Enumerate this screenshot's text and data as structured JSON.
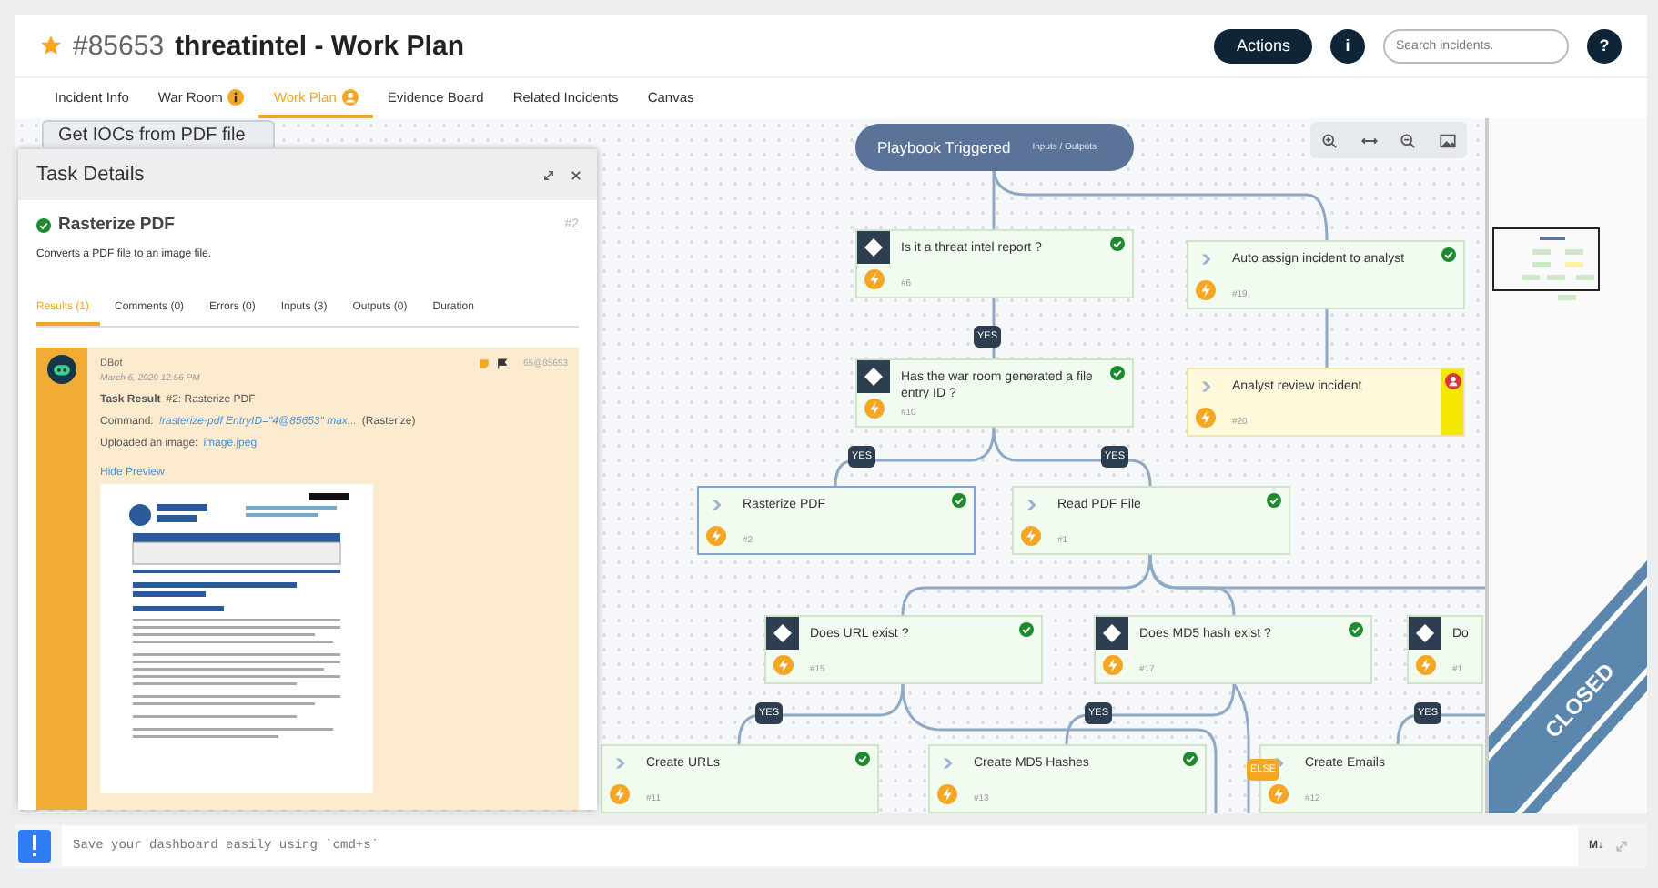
{
  "header": {
    "starred": true,
    "incident_id": "#85653",
    "title": "threatintel - Work Plan",
    "actions_label": "Actions",
    "info_label": "i",
    "search": {
      "placeholder": "Search incidents."
    },
    "help_label": "?"
  },
  "tabs": [
    {
      "kind": "plain",
      "label": "Incident Info",
      "selected": false
    },
    {
      "kind": "info",
      "label": "War Room",
      "selected": false
    },
    {
      "kind": "user",
      "label": "Work Plan",
      "selected": true
    },
    {
      "kind": "plain",
      "label": "Evidence Board",
      "selected": false
    },
    {
      "kind": "plain",
      "label": "Related Incidents",
      "selected": false
    },
    {
      "kind": "plain",
      "label": "Canvas",
      "selected": false
    }
  ],
  "canvas": {
    "nodes": [
      {
        "kind": "plain",
        "title": "Get IOCs from PDF file"
      },
      {
        "kind": "trigger",
        "title": "Playbook Triggered",
        "subtitle": "Inputs / Outputs"
      },
      {
        "kind": "decision",
        "title": "Is it a threat intel report ?",
        "id": "#6",
        "completed": true,
        "waiting": false,
        "selected": false
      },
      {
        "kind": "action",
        "title": "Auto assign incident to analyst",
        "id": "#19",
        "completed": true,
        "waiting": false,
        "selected": false
      },
      {
        "kind": "decision",
        "title": "Has the war room generated a file entry ID ?",
        "id": "#10",
        "completed": true,
        "waiting": false,
        "selected": false
      },
      {
        "kind": "action",
        "title": "Analyst review incident",
        "id": "#20",
        "completed": false,
        "waiting": true,
        "selected": false
      },
      {
        "kind": "action",
        "title": "Rasterize PDF",
        "id": "#2",
        "completed": true,
        "waiting": false,
        "selected": true
      },
      {
        "kind": "action",
        "title": "Read PDF File",
        "id": "#1",
        "completed": true,
        "waiting": false,
        "selected": false
      },
      {
        "kind": "decision",
        "title": "Does URL exist ?",
        "id": "#15",
        "completed": true,
        "waiting": false,
        "selected": false
      },
      {
        "kind": "decision",
        "title": "Does MD5 hash exist ?",
        "id": "#17",
        "completed": true,
        "waiting": false,
        "selected": false
      },
      {
        "kind": "decision",
        "title": "Do",
        "id": "#1",
        "completed": false,
        "waiting": false,
        "selected": false
      },
      {
        "kind": "action",
        "title": "Create URLs",
        "id": "#11",
        "completed": true,
        "waiting": false,
        "selected": false
      },
      {
        "kind": "action",
        "title": "Create MD5 Hashes",
        "id": "#13",
        "completed": true,
        "waiting": false,
        "selected": false
      },
      {
        "kind": "action",
        "title": "Create Emails",
        "id": "#12",
        "completed": false,
        "waiting": false,
        "selected": false
      }
    ],
    "edge_labels": [
      {
        "kind": "yes",
        "text": "YES"
      },
      {
        "kind": "yes",
        "text": "YES"
      },
      {
        "kind": "yes",
        "text": "YES"
      },
      {
        "kind": "yes",
        "text": "YES"
      },
      {
        "kind": "yes",
        "text": "YES"
      },
      {
        "kind": "yes",
        "text": "YES"
      },
      {
        "kind": "else",
        "text": "ELSE"
      }
    ],
    "incident_status": "CLOSED"
  },
  "task_details": {
    "title": "Task Details",
    "task": {
      "name": "Rasterize PDF",
      "completed": true,
      "id": "#2",
      "description": "Converts a PDF file to an image file."
    },
    "tabs": [
      {
        "label": "Results (1)",
        "selected": true
      },
      {
        "label": "Comments (0)",
        "selected": false
      },
      {
        "label": "Errors (0)",
        "selected": false
      },
      {
        "label": "Inputs (3)",
        "selected": false
      },
      {
        "label": "Outputs (0)",
        "selected": false
      },
      {
        "label": "Duration",
        "selected": false
      }
    ],
    "entry": {
      "author": "DBot",
      "time": "March 6, 2020 12:56 PM",
      "ref": "65@85653",
      "result": "**Task Result** #2: Rasterize PDF",
      "command_label": "Command:",
      "command": "!rasterize-pdf EntryID=\"4@85653\" max...",
      "command_source": "(Rasterize)",
      "upload_label": "Uploaded an image:",
      "upload_file": "image.jpeg",
      "preview_toggle": "Hide Preview"
    }
  },
  "bottom_bar": {
    "placeholder": "Save your dashboard easily using `cmd+s`",
    "markdown_label": "M↓"
  }
}
